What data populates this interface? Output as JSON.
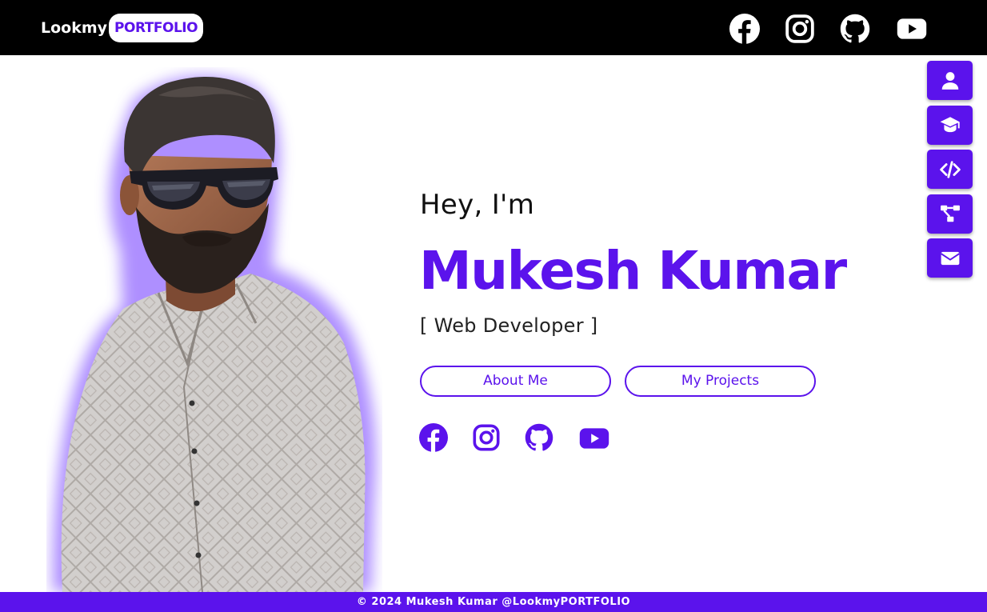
{
  "header": {
    "logo_text": "Lookmy",
    "logo_pill": "PORTFOLIO",
    "social_icons": [
      "facebook-icon",
      "instagram-icon",
      "github-icon",
      "youtube-icon"
    ]
  },
  "side_nav": {
    "items": [
      "user-icon",
      "graduation-cap-icon",
      "code-icon",
      "sitemap-icon",
      "envelope-icon"
    ]
  },
  "hero": {
    "greeting": "Hey, I'm",
    "name": "Mukesh Kumar",
    "role": "[ Web Developer ]",
    "about_button": "About Me",
    "projects_button": "My Projects",
    "social_icons": [
      "facebook-icon",
      "instagram-icon",
      "github-icon",
      "youtube-icon"
    ]
  },
  "footer": {
    "text": "© 2024 Mukesh Kumar @LookmyPORTFOLIO"
  },
  "colors": {
    "accent": "#5b13ec",
    "navbar": "#000000",
    "background": "#ffffff"
  }
}
